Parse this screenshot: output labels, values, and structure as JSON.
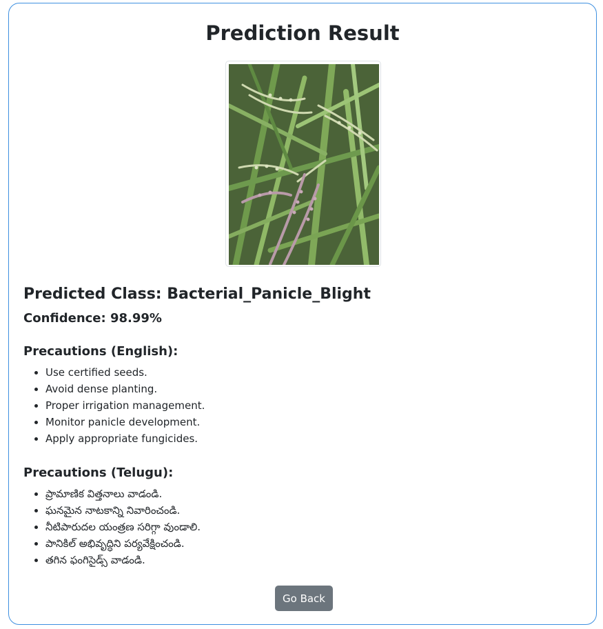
{
  "page": {
    "title": "Prediction Result"
  },
  "image": {
    "subject": "rice panicles in paddy field"
  },
  "result": {
    "predicted_class": "Predicted Class: Bacterial_Panicle_Blight",
    "confidence": "Confidence: 98.99%"
  },
  "precautions_english": {
    "heading": "Precautions (English):",
    "items": [
      "Use certified seeds.",
      "Avoid dense planting.",
      "Proper irrigation management.",
      "Monitor panicle development.",
      "Apply appropriate fungicides."
    ]
  },
  "precautions_telugu": {
    "heading": "Precautions (Telugu):",
    "items": [
      "ప్రామాణిక విత్తనాలు వాడండి.",
      "ఘనమైన నాటకాన్ని నివారించండి.",
      "నీటిపారుదల యంత్రణ సరిగ్గా వుండాలి.",
      "పానికిల్ అభివృద్ధిని పర్యవేక్షించండి.",
      "తగిన ఫంగిసైడ్స్ వాడండి."
    ]
  },
  "actions": {
    "back_label": "Go Back"
  },
  "colors": {
    "card_border": "#3d8fe0",
    "button_bg": "#6c757d",
    "text": "#212529"
  }
}
